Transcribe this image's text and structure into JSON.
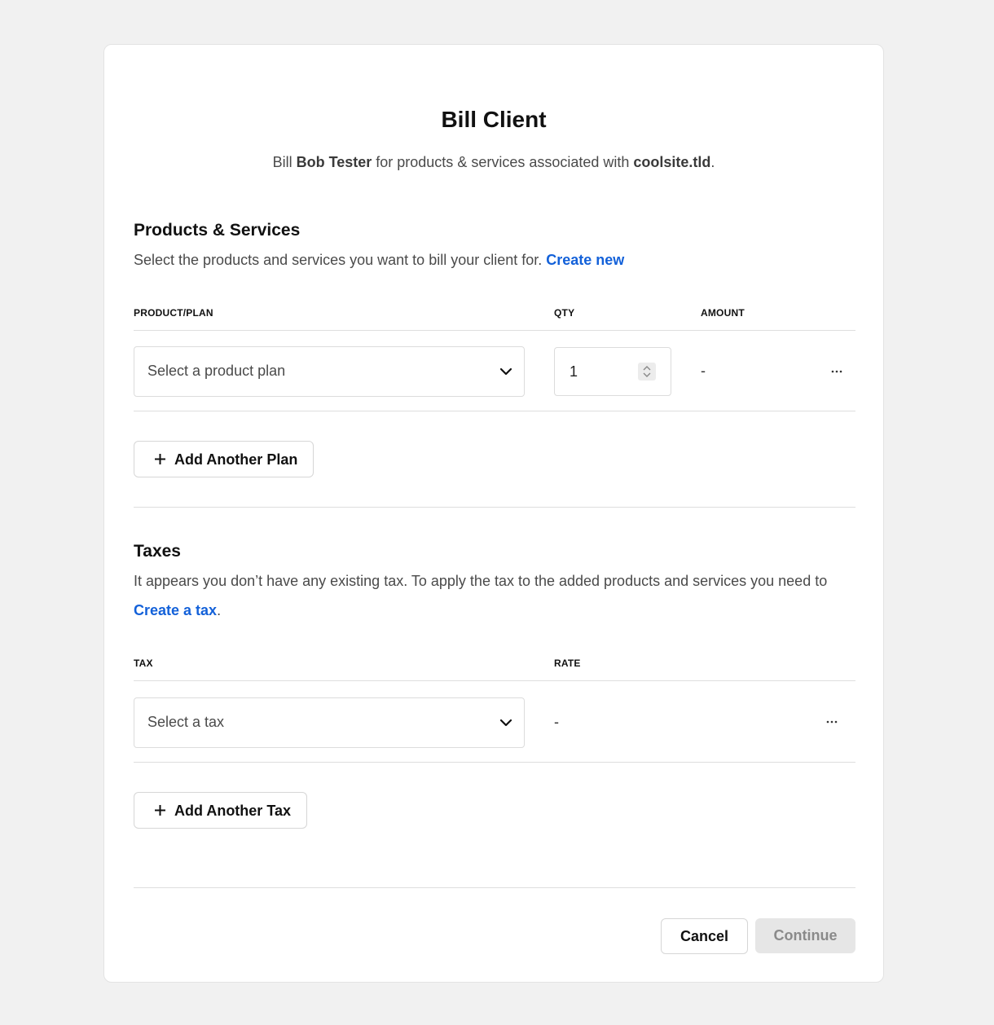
{
  "header": {
    "title": "Bill Client",
    "subtitle_prefix": "Bill ",
    "client_name": "Bob Tester",
    "subtitle_middle": " for products & services associated with ",
    "domain": "coolsite.tld",
    "subtitle_suffix": "."
  },
  "products": {
    "title": "Products & Services",
    "description": "Select the products and services you want to bill your client for. ",
    "create_link": "Create new",
    "columns": [
      "PRODUCT/PLAN",
      "QTY",
      "AMOUNT"
    ],
    "row": {
      "plan_placeholder": "Select a product plan",
      "qty": "1",
      "amount": "-"
    },
    "add_button": "Add Another Plan"
  },
  "taxes": {
    "title": "Taxes",
    "description": "It appears you don’t have any existing tax. To apply the tax to the added products and services you need to",
    "create_link": "Create a tax",
    "description_end": ".",
    "columns": [
      "TAX",
      "RATE"
    ],
    "row": {
      "tax_placeholder": "Select a tax",
      "rate": "-"
    },
    "add_button": "Add Another Tax"
  },
  "footer": {
    "cancel": "Cancel",
    "continue": "Continue"
  },
  "icons": {
    "chevron": "chevron-down-icon",
    "more": "more-horizontal-icon",
    "plus": "plus-icon",
    "spinner": "number-spinner-icon"
  },
  "colors": {
    "link": "#1361d9",
    "background": "#f1f1f1",
    "disabled_button": "#e6e6e6"
  }
}
